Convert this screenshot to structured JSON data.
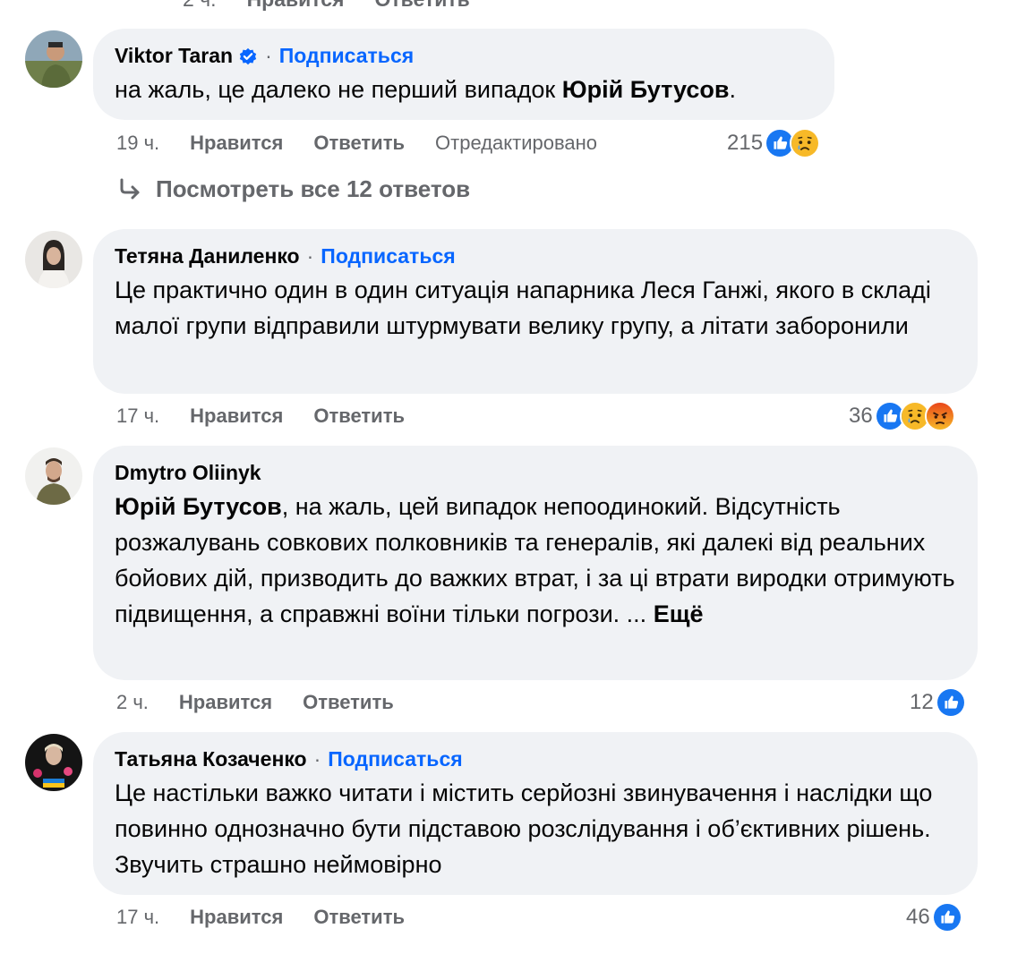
{
  "top": {
    "time": "2 ч.",
    "like_label": "Нравится",
    "reply_label": "Ответить"
  },
  "comments": [
    {
      "author": "Viktor Taran",
      "verified": true,
      "follow_label": "Подписаться",
      "text_before": "на жаль, це далеко не перший випадок ",
      "mention": "Юрій Бутусов",
      "text_after": ".",
      "time": "19 ч.",
      "like_label": "Нравится",
      "reply_label": "Ответить",
      "edited_label": "Отредактировано",
      "reaction_count": "215",
      "reactions": [
        "like-icon",
        "sad-icon"
      ]
    },
    {
      "author": "Тетяна Даниленко",
      "follow_label": "Подписаться",
      "text": "Це практично один в один ситуація напарника Леся Ганжі, якого в складі малої групи відправили штурмувати велику групу, а літати заборонили",
      "time": "17 ч.",
      "like_label": "Нравится",
      "reply_label": "Ответить",
      "reaction_count": "36",
      "reactions": [
        "like-icon",
        "sad-icon",
        "angry-icon"
      ]
    },
    {
      "author": "Dmytro Oliinyk",
      "mention": "Юрій Бутусов",
      "text_after": ", на жаль, цей випадок непоодинокий. Відсутність розжалувань совкових полковників та генералів, які далекі від реальних бойових дій, призводить до важких втрат, і за ці втрати виродки отримують підвищення, а справжні воїни тільки погрози. ... ",
      "more_label": "Ещё",
      "time": "2 ч.",
      "like_label": "Нравится",
      "reply_label": "Ответить",
      "reaction_count": "12",
      "reactions": [
        "like-icon"
      ]
    },
    {
      "author": "Татьяна Козаченко",
      "follow_label": "Подписаться",
      "text": "Це настільки важко читати і містить серйозні звинувачення і наслідки що повинно однозначно бути підставою розслідування і об’єктивних рішень. Звучить страшно неймовірно",
      "time": "17 ч.",
      "like_label": "Нравится",
      "reply_label": "Ответить",
      "reaction_count": "46",
      "reactions": [
        "like-icon"
      ]
    }
  ],
  "view_replies_label": "Посмотреть все 12 ответов",
  "colors": {
    "bubble": "#f0f2f5",
    "link_blue": "#0866ff",
    "secondary_text": "#65676b",
    "like_blue": "#1877f2",
    "sad_yellow": "#f7b928",
    "angry_red": "#e9710f"
  }
}
